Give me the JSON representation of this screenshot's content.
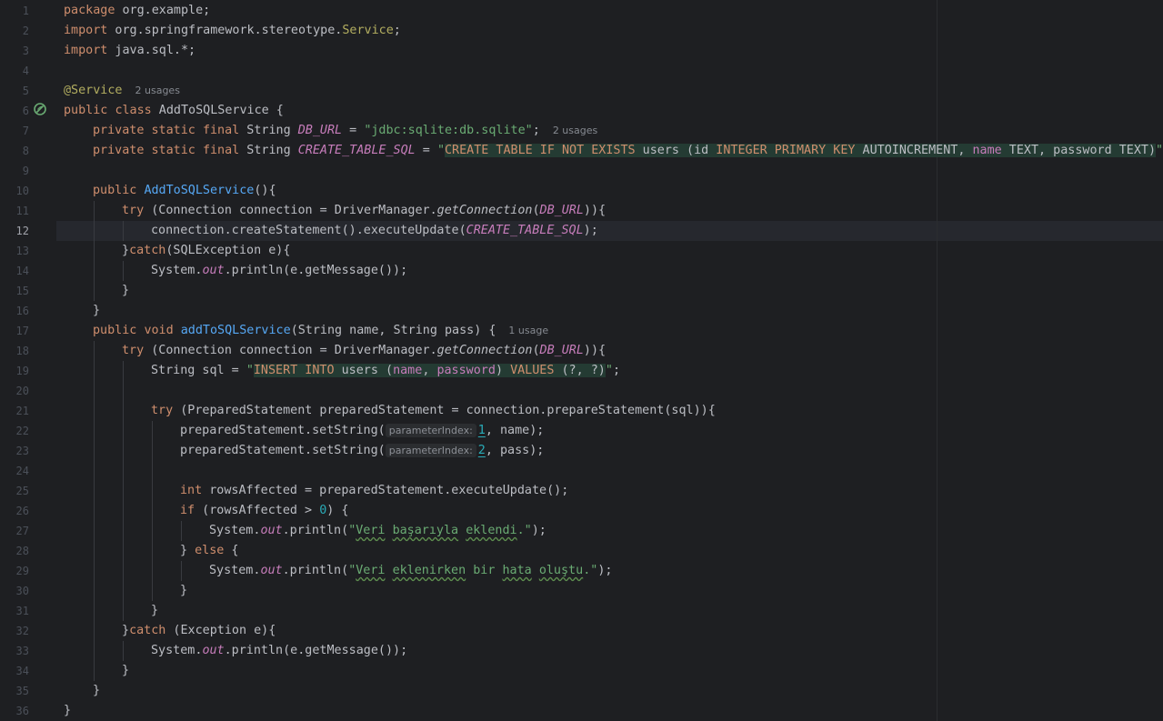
{
  "editor": {
    "current_line": 12,
    "lines": [
      {
        "n": "1",
        "indent": 0,
        "tokens": [
          {
            "t": "package",
            "c": "kw"
          },
          {
            "t": " org.example;"
          }
        ]
      },
      {
        "n": "2",
        "indent": 0,
        "tokens": [
          {
            "t": "import",
            "c": "kw"
          },
          {
            "t": " org.springframework.stereotype."
          },
          {
            "t": "Service",
            "c": "ann"
          },
          {
            "t": ";"
          }
        ]
      },
      {
        "n": "3",
        "indent": 0,
        "tokens": [
          {
            "t": "import",
            "c": "kw"
          },
          {
            "t": " java.sql.*;"
          }
        ]
      },
      {
        "n": "4",
        "indent": 0,
        "tokens": []
      },
      {
        "n": "5",
        "indent": 0,
        "tokens": [
          {
            "t": "@Service",
            "c": "ann"
          },
          {
            "t": "2 usages",
            "c": "hint usage"
          }
        ]
      },
      {
        "n": "6",
        "indent": 0,
        "tokens": [
          {
            "t": "public",
            "c": "kw"
          },
          {
            "t": " "
          },
          {
            "t": "class",
            "c": "kw"
          },
          {
            "t": " AddToSQLService {"
          }
        ]
      },
      {
        "n": "7",
        "indent": 1,
        "tokens": [
          {
            "t": "private",
            "c": "kw"
          },
          {
            "t": " "
          },
          {
            "t": "static",
            "c": "kw"
          },
          {
            "t": " "
          },
          {
            "t": "final",
            "c": "kw"
          },
          {
            "t": " String "
          },
          {
            "t": "DB_URL",
            "c": "sfld"
          },
          {
            "t": " = "
          },
          {
            "t": "\"jdbc:sqlite:db.sqlite\"",
            "c": "str"
          },
          {
            "t": ";"
          },
          {
            "t": "2 usages",
            "c": "hint usage"
          }
        ]
      },
      {
        "n": "8",
        "indent": 1,
        "tokens": [
          {
            "t": "private",
            "c": "kw"
          },
          {
            "t": " "
          },
          {
            "t": "static",
            "c": "kw"
          },
          {
            "t": " "
          },
          {
            "t": "final",
            "c": "kw"
          },
          {
            "t": " String "
          },
          {
            "t": "CREATE_TABLE_SQL",
            "c": "sfld"
          },
          {
            "t": " = "
          },
          {
            "t": "\"",
            "c": "str"
          },
          {
            "t": "CREATE TABLE IF NOT EXISTS",
            "c": "sqlkw inj"
          },
          {
            "t": " users (id ",
            "c": "sqltxt inj"
          },
          {
            "t": "INTEGER PRIMARY KEY",
            "c": "sqlkw inj"
          },
          {
            "t": " AUTOINCREMENT, ",
            "c": "sqltxt inj"
          },
          {
            "t": "name",
            "c": "sqlcol inj"
          },
          {
            "t": " TEXT, password TEXT)",
            "c": "sqltxt inj"
          },
          {
            "t": "\"",
            "c": "str"
          },
          {
            "t": ";"
          }
        ]
      },
      {
        "n": "9",
        "indent": 1,
        "tokens": []
      },
      {
        "n": "10",
        "indent": 1,
        "tokens": [
          {
            "t": "public",
            "c": "kw"
          },
          {
            "t": " "
          },
          {
            "t": "AddToSQLService",
            "c": "mdecl"
          },
          {
            "t": "(){"
          }
        ]
      },
      {
        "n": "11",
        "indent": 2,
        "tokens": [
          {
            "t": "try",
            "c": "kw"
          },
          {
            "t": " (Connection connection = DriverManager."
          },
          {
            "t": "getConnection",
            "c": "it"
          },
          {
            "t": "("
          },
          {
            "t": "DB_URL",
            "c": "sfld"
          },
          {
            "t": ")){"
          }
        ]
      },
      {
        "n": "12",
        "indent": 3,
        "tokens": [
          {
            "t": "connection.createStatement().executeUpdate("
          },
          {
            "t": "CREATE_TABLE_SQL",
            "c": "sfld"
          },
          {
            "t": ");"
          }
        ]
      },
      {
        "n": "13",
        "indent": 2,
        "tokens": [
          {
            "t": "}"
          },
          {
            "t": "catch",
            "c": "kw"
          },
          {
            "t": "(SQLException e){"
          }
        ]
      },
      {
        "n": "14",
        "indent": 3,
        "tokens": [
          {
            "t": "System."
          },
          {
            "t": "out",
            "c": "fld"
          },
          {
            "t": ".println(e.getMessage());"
          }
        ]
      },
      {
        "n": "15",
        "indent": 2,
        "tokens": [
          {
            "t": "}"
          }
        ]
      },
      {
        "n": "16",
        "indent": 1,
        "tokens": [
          {
            "t": "}"
          }
        ]
      },
      {
        "n": "17",
        "indent": 1,
        "tokens": [
          {
            "t": "public",
            "c": "kw"
          },
          {
            "t": " "
          },
          {
            "t": "void",
            "c": "kw"
          },
          {
            "t": " "
          },
          {
            "t": "addToSQLService",
            "c": "mdecl"
          },
          {
            "t": "(String name, String pass) {"
          },
          {
            "t": "1 usage",
            "c": "hint usage"
          }
        ]
      },
      {
        "n": "18",
        "indent": 2,
        "tokens": [
          {
            "t": "try",
            "c": "kw"
          },
          {
            "t": " (Connection connection = DriverManager."
          },
          {
            "t": "getConnection",
            "c": "it"
          },
          {
            "t": "("
          },
          {
            "t": "DB_URL",
            "c": "sfld"
          },
          {
            "t": ")){"
          }
        ]
      },
      {
        "n": "19",
        "indent": 3,
        "tokens": [
          {
            "t": "String sql = "
          },
          {
            "t": "\"",
            "c": "str"
          },
          {
            "t": "INSERT INTO",
            "c": "sqlkw inj"
          },
          {
            "t": " users (",
            "c": "sqltxt inj"
          },
          {
            "t": "name",
            "c": "sqlcol inj"
          },
          {
            "t": ", ",
            "c": "sqltxt inj"
          },
          {
            "t": "password",
            "c": "sqlcol inj"
          },
          {
            "t": ") ",
            "c": "sqltxt inj"
          },
          {
            "t": "VALUES",
            "c": "sqlkw inj"
          },
          {
            "t": " (?, ?)",
            "c": "sqltxt inj"
          },
          {
            "t": "\"",
            "c": "str"
          },
          {
            "t": ";"
          }
        ]
      },
      {
        "n": "20",
        "indent": 3,
        "tokens": []
      },
      {
        "n": "21",
        "indent": 3,
        "tokens": [
          {
            "t": "try",
            "c": "kw"
          },
          {
            "t": " (PreparedStatement preparedStatement = connection.prepareStatement(sql)){"
          }
        ]
      },
      {
        "n": "22",
        "indent": 4,
        "tokens": [
          {
            "t": "preparedStatement.setString("
          },
          {
            "t": "parameterIndex:",
            "c": "hint inlay"
          },
          {
            "t": "1",
            "c": "num u"
          },
          {
            "t": ", name);"
          }
        ]
      },
      {
        "n": "23",
        "indent": 4,
        "tokens": [
          {
            "t": "preparedStatement.setString("
          },
          {
            "t": "parameterIndex:",
            "c": "hint inlay"
          },
          {
            "t": "2",
            "c": "num u"
          },
          {
            "t": ", pass);"
          }
        ]
      },
      {
        "n": "24",
        "indent": 4,
        "tokens": []
      },
      {
        "n": "25",
        "indent": 4,
        "tokens": [
          {
            "t": "int",
            "c": "kw"
          },
          {
            "t": " rowsAffected = preparedStatement.executeUpdate();"
          }
        ]
      },
      {
        "n": "26",
        "indent": 4,
        "tokens": [
          {
            "t": "if",
            "c": "kw"
          },
          {
            "t": " (rowsAffected > "
          },
          {
            "t": "0",
            "c": "num"
          },
          {
            "t": ") {"
          }
        ]
      },
      {
        "n": "27",
        "indent": 5,
        "tokens": [
          {
            "t": "System."
          },
          {
            "t": "out",
            "c": "fld"
          },
          {
            "t": ".println("
          },
          {
            "t": "\"",
            "c": "str"
          },
          {
            "t": "Veri",
            "c": "str typo"
          },
          {
            "t": " ",
            "c": "str"
          },
          {
            "t": "başarıyla",
            "c": "str typo"
          },
          {
            "t": " ",
            "c": "str"
          },
          {
            "t": "eklendi",
            "c": "str typo"
          },
          {
            "t": ".\"",
            "c": "str"
          },
          {
            "t": ");"
          }
        ]
      },
      {
        "n": "28",
        "indent": 4,
        "tokens": [
          {
            "t": "} "
          },
          {
            "t": "else",
            "c": "kw"
          },
          {
            "t": " {"
          }
        ]
      },
      {
        "n": "29",
        "indent": 5,
        "tokens": [
          {
            "t": "System."
          },
          {
            "t": "out",
            "c": "fld"
          },
          {
            "t": ".println("
          },
          {
            "t": "\"",
            "c": "str"
          },
          {
            "t": "Veri",
            "c": "str typo"
          },
          {
            "t": " ",
            "c": "str"
          },
          {
            "t": "eklenirken",
            "c": "str typo"
          },
          {
            "t": " bir ",
            "c": "str"
          },
          {
            "t": "hata",
            "c": "str typo"
          },
          {
            "t": " ",
            "c": "str"
          },
          {
            "t": "oluştu",
            "c": "str typo"
          },
          {
            "t": ".\"",
            "c": "str"
          },
          {
            "t": ");"
          }
        ]
      },
      {
        "n": "30",
        "indent": 4,
        "tokens": [
          {
            "t": "}"
          }
        ]
      },
      {
        "n": "31",
        "indent": 3,
        "tokens": [
          {
            "t": "}"
          }
        ]
      },
      {
        "n": "32",
        "indent": 2,
        "tokens": [
          {
            "t": "}"
          },
          {
            "t": "catch",
            "c": "kw"
          },
          {
            "t": " (Exception e){"
          }
        ]
      },
      {
        "n": "33",
        "indent": 3,
        "tokens": [
          {
            "t": "System."
          },
          {
            "t": "out",
            "c": "fld"
          },
          {
            "t": ".println(e.getMessage());"
          }
        ]
      },
      {
        "n": "34",
        "indent": 2,
        "tokens": [
          {
            "t": "}"
          }
        ]
      },
      {
        "n": "35",
        "indent": 1,
        "tokens": [
          {
            "t": "}"
          }
        ]
      },
      {
        "n": "36",
        "indent": 0,
        "tokens": [
          {
            "t": "}"
          }
        ]
      }
    ]
  },
  "gutter_icons": [
    {
      "line": "6",
      "icon": "spring-bean-icon",
      "color": "#6aab73"
    }
  ],
  "colors": {
    "background": "#1e1f22",
    "keyword": "#cf8e6d",
    "string": "#6aab73",
    "annotation": "#b3ae60",
    "static_field": "#c77dbb",
    "method_declaration": "#56a8f5",
    "number": "#2aacb8",
    "current_line": "#26282e"
  }
}
